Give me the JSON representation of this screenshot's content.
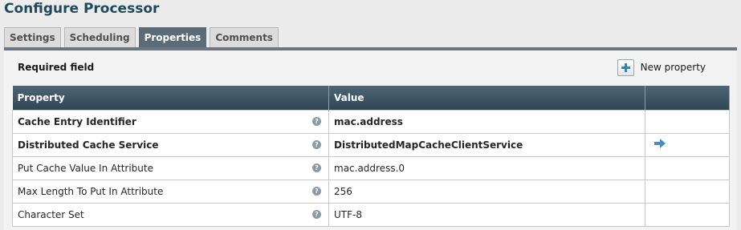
{
  "dialog": {
    "title": "Configure Processor"
  },
  "tabs": [
    {
      "label": "Settings"
    },
    {
      "label": "Scheduling"
    },
    {
      "label": "Properties",
      "active": true
    },
    {
      "label": "Comments"
    }
  ],
  "properties_panel": {
    "required_label": "Required field",
    "new_property_label": "New property",
    "new_property_icon": "plus-icon",
    "help_icon": "help-icon",
    "goto_icon": "arrow-right-icon",
    "columns": {
      "property": "Property",
      "value": "Value"
    },
    "rows": [
      {
        "name": "Cache Entry Identifier",
        "value": "mac.address",
        "required": true
      },
      {
        "name": "Distributed Cache Service",
        "value": "DistributedMapCacheClientService",
        "required": true,
        "has_goto": true
      },
      {
        "name": "Put Cache Value In Attribute",
        "value": "mac.address.0",
        "required": false
      },
      {
        "name": "Max Length To Put In Attribute",
        "value": "256",
        "required": false
      },
      {
        "name": "Character Set",
        "value": "UTF-8",
        "required": false
      }
    ]
  },
  "colors": {
    "title": "#1f4a5c",
    "active_tab": "#5b6c78",
    "table_header": "#3f5665",
    "help_icon": "#8a9aa6",
    "goto_arrow": "#4a8bc2"
  }
}
